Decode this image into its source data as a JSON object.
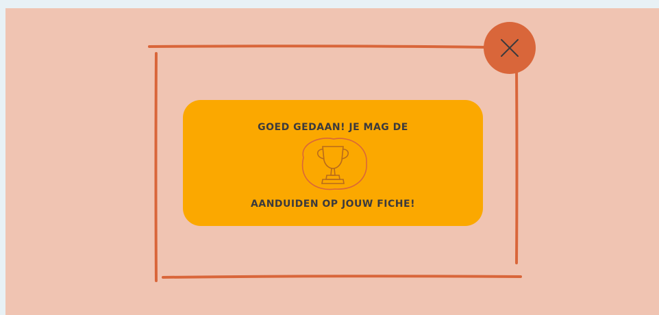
{
  "popup": {
    "message_line1": "GOED GEDAAN! JE MAG DE",
    "message_line2": "AANDUIDEN OP JOUW FICHE!",
    "badge_icon": "trophy-icon",
    "close_icon": "close-icon"
  },
  "colors": {
    "overlay": "#f0c4b2",
    "frame": "#d9663a",
    "card": "#fba800",
    "text": "#3b3a3d",
    "background": "#e8f1f5"
  }
}
